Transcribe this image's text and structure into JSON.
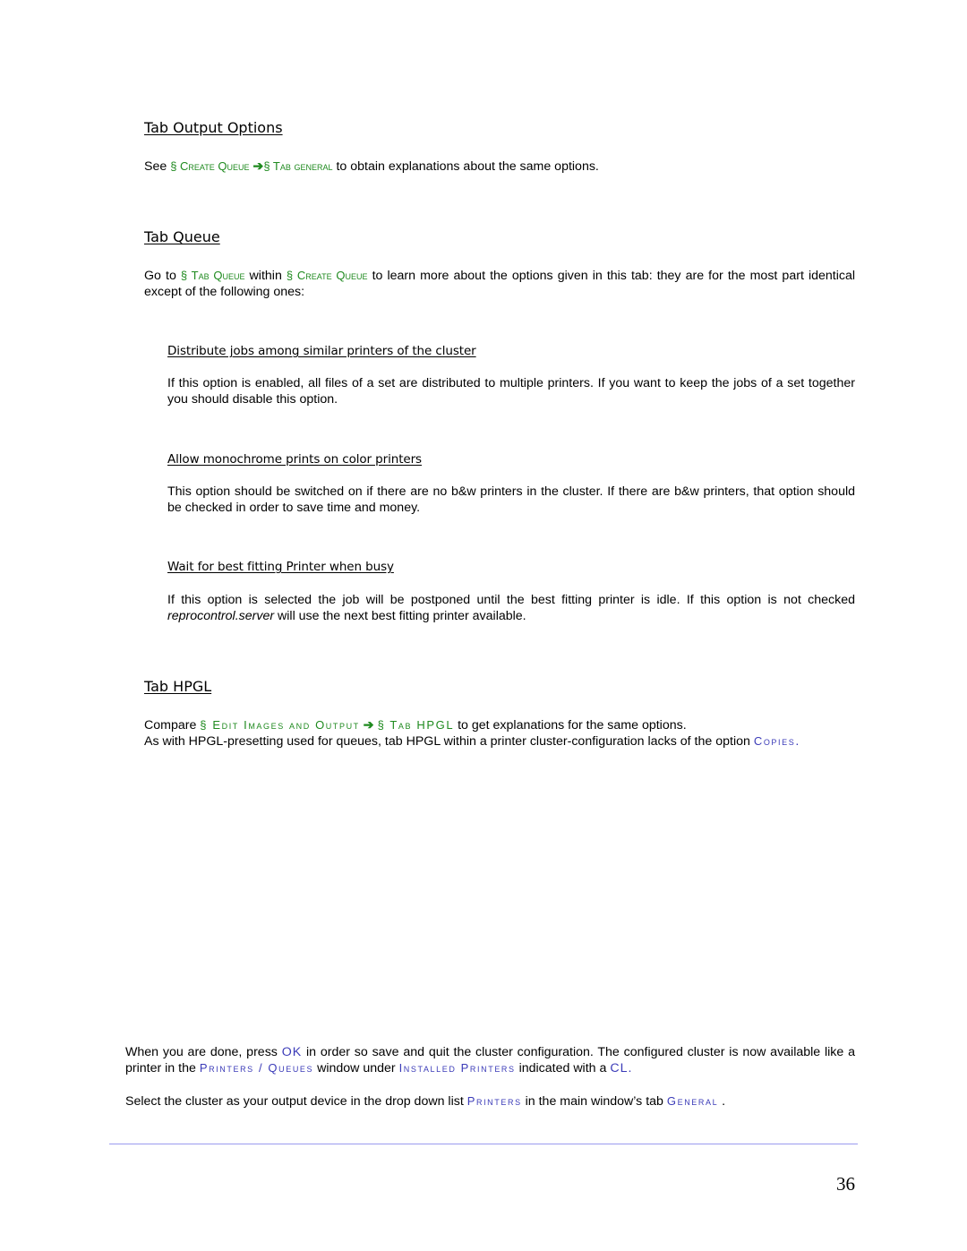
{
  "sections": {
    "output_options": {
      "heading": "Tab Output Options",
      "text_before": "See ",
      "link1": "§ Create Queue",
      "arrow": "➔",
      "link2": "§ Tab general",
      "text_after": " to obtain explanations about the same options."
    },
    "queue": {
      "heading": "Tab Queue",
      "text_1": "Go to ",
      "link1": "§ Tab Queue",
      "text_2": " within ",
      "link2": "§ Create Queue",
      "text_3": " to learn more about the options given in this tab: they are for the most part identical except of the following ones:",
      "subsections": [
        {
          "heading": "Distribute jobs among similar printers of the cluster",
          "text": "If this option is enabled, all files of a set are distributed to multiple printers. If you want to keep the jobs of a set together you should disable this option."
        },
        {
          "heading": "Allow monochrome prints on color printers",
          "text": "This option should be switched on if there are no b&w printers in the cluster. If there are b&w printers, that option should be checked in order to save time and money."
        },
        {
          "heading": "Wait for best fitting Printer when busy",
          "text_1": "If this option is selected the job will be postponed until the best fitting printer is idle. If this option is not checked ",
          "text_italic": "reprocontrol.server",
          "text_2": " will use the next best fitting printer available."
        }
      ]
    },
    "hpgl": {
      "heading": "Tab HPGL",
      "line1_before": "Compare ",
      "link1": "§ Edit Images and Output",
      "arrow": "➔",
      "link2": "§ Tab HPGL",
      "line1_after": " to get explanations for the same options.",
      "line2_before": "As with HPGL-presetting used for queues, tab HPGL within a printer cluster-configuration lacks of the option ",
      "line2_link": "Copies",
      "line2_after": "."
    }
  },
  "closing": {
    "p1_1": "When you are done, press ",
    "ok": "OK",
    "p1_2": " in order so save and quit the cluster configuration. The configured cluster is now available like a printer in the ",
    "printers_queues": "Printers / Queues",
    "p1_3": " window under ",
    "installed_printers": "Installed Printers",
    "p1_4": " indicated with a ",
    "cl": "CL.",
    "p2_1": "Select the cluster as your output device in the drop down list ",
    "printers": "Printers",
    "p2_2": " in the main window’s tab ",
    "general": "General",
    "p2_3": " ."
  },
  "page_number": "36"
}
